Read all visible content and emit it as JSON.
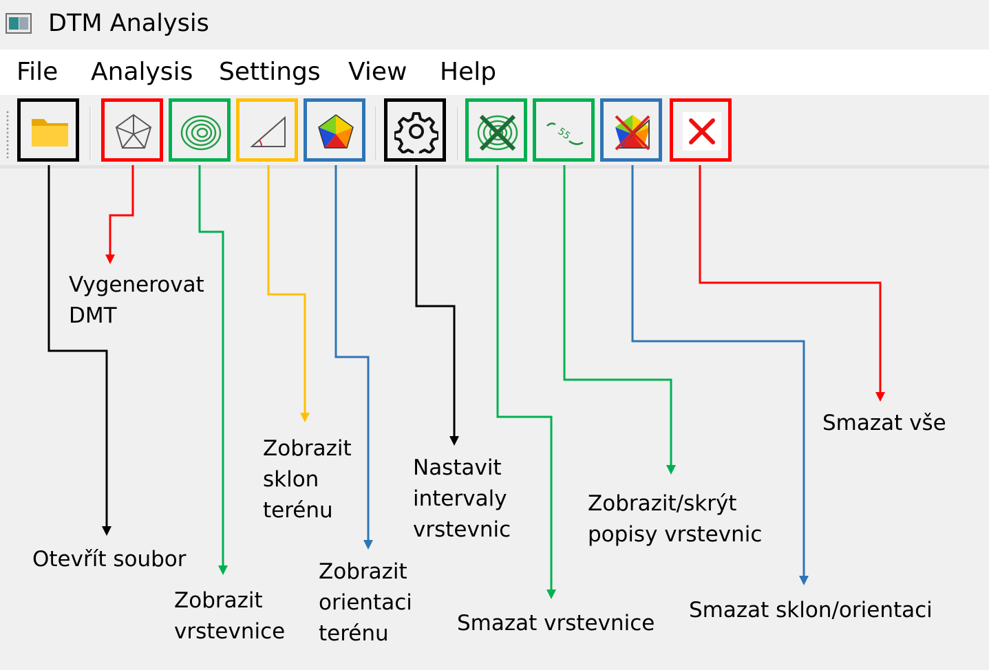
{
  "window": {
    "title": "DTM Analysis"
  },
  "menu": [
    "File",
    "Analysis",
    "Settings",
    "View",
    "Help"
  ],
  "colors": {
    "black": "#000000",
    "red": "#ff0000",
    "green": "#00b050",
    "yellow": "#ffc000",
    "blue": "#2e75b6"
  },
  "toolbar": {
    "buttons": [
      {
        "icon": "open-folder-icon",
        "label_lines": [
          "Otevřít soubor"
        ]
      },
      {
        "icon": "generate-dmt-icon",
        "label_lines": [
          "Vygenerovat",
          "DMT"
        ]
      },
      {
        "icon": "contour-lines-icon",
        "label_lines": [
          "Zobrazit",
          "vrstevnice"
        ]
      },
      {
        "icon": "terrain-slope-icon",
        "label_lines": [
          "Zobrazit",
          "sklon",
          "terénu"
        ]
      },
      {
        "icon": "terrain-orientation-icon",
        "label_lines": [
          "Zobrazit",
          "orientaci",
          "terénu"
        ]
      },
      {
        "icon": "gear-icon",
        "label_lines": [
          "Nastavit",
          "intervaly",
          "vrstevnic"
        ]
      },
      {
        "icon": "delete-contours-icon",
        "label_lines": [
          "Smazat vrstevnice"
        ]
      },
      {
        "icon": "contour-labels-icon",
        "label_lines": [
          "Zobrazit/skrýt",
          "popisy vrstevnic"
        ]
      },
      {
        "icon": "delete-slope-orientation-icon",
        "label_lines": [
          "Smazat sklon/orientaci"
        ]
      },
      {
        "icon": "clear-all-icon",
        "label_lines": [
          "Smazat vše"
        ]
      }
    ]
  }
}
